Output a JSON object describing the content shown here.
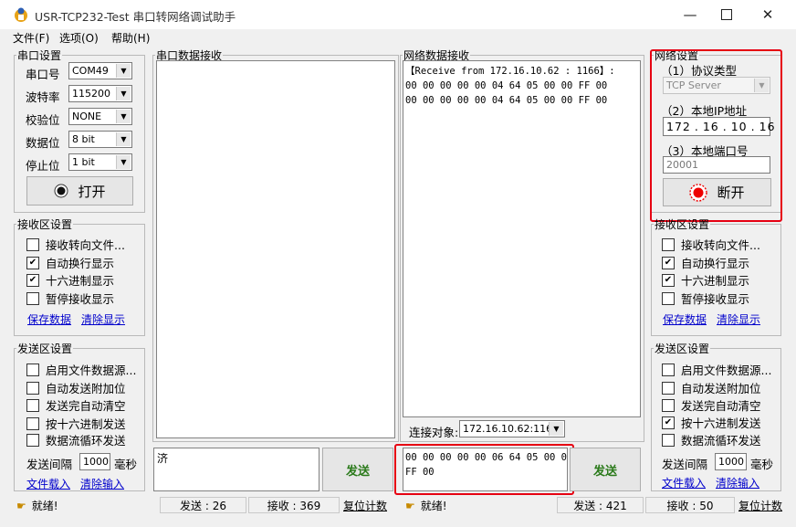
{
  "window": {
    "title": "USR-TCP232-Test  串口转网络调试助手",
    "minimize_icon": "minimize-icon",
    "maximize_icon": "maximize-icon",
    "close_icon": "close-icon"
  },
  "menu": [
    "文件(F)",
    "选项(O)",
    "帮助(H)"
  ],
  "serial_settings": {
    "title": "串口设置",
    "fields": [
      {
        "label": "串口号",
        "value": "COM49"
      },
      {
        "label": "波特率",
        "value": "115200"
      },
      {
        "label": "校验位",
        "value": "NONE"
      },
      {
        "label": "数据位",
        "value": "8 bit"
      },
      {
        "label": "停止位",
        "value": "1 bit"
      }
    ],
    "open_button": "打开"
  },
  "left_recv_settings": {
    "title": "接收区设置",
    "options": [
      {
        "label": "接收转向文件...",
        "checked": false
      },
      {
        "label": "自动换行显示",
        "checked": true
      },
      {
        "label": "十六进制显示",
        "checked": true
      },
      {
        "label": "暂停接收显示",
        "checked": false
      }
    ],
    "save_link": "保存数据",
    "clear_link": "清除显示"
  },
  "left_send_settings": {
    "title": "发送区设置",
    "options": [
      {
        "label": "启用文件数据源...",
        "checked": false
      },
      {
        "label": "自动发送附加位",
        "checked": false
      },
      {
        "label": "发送完自动清空",
        "checked": false
      },
      {
        "label": "按十六进制发送",
        "checked": false
      },
      {
        "label": "数据流循环发送",
        "checked": false
      }
    ],
    "interval_label": "发送间隔",
    "interval_value": "1000",
    "interval_unit": "毫秒",
    "load_link": "文件载入",
    "clear_link": "清除输入"
  },
  "serial_receive": {
    "title": "串口数据接收",
    "content": ""
  },
  "serial_send": {
    "content": "济",
    "send_button": "发送"
  },
  "net_receive": {
    "title": "网络数据接收",
    "lines": [
      "【Receive from 172.16.10.62 : 1166】:",
      "00 00 00 00 00 04 64 05 00 00 FF 00",
      "00 00 00 00 00 04 64 05 00 00 FF 00"
    ]
  },
  "connection": {
    "label": "连接对象:",
    "value": "172.16.10.62:1166"
  },
  "net_send": {
    "lines": [
      "00 00 00 00 00 06 64 05 00 00",
      "FF 00"
    ],
    "send_button": "发送"
  },
  "net_settings": {
    "title": "网络设置",
    "protocol_label": "（1）协议类型",
    "protocol_value": "TCP Server",
    "ip_label": "（2）本地IP地址",
    "ip_parts": [
      "172",
      "16",
      "10",
      "16"
    ],
    "port_label": "（3）本地端口号",
    "port_value": "20001",
    "disconnect_button": "断开"
  },
  "right_recv_settings": {
    "title": "接收区设置",
    "options": [
      {
        "label": "接收转向文件...",
        "checked": false
      },
      {
        "label": "自动换行显示",
        "checked": true
      },
      {
        "label": "十六进制显示",
        "checked": true
      },
      {
        "label": "暂停接收显示",
        "checked": false
      }
    ],
    "save_link": "保存数据",
    "clear_link": "清除显示"
  },
  "right_send_settings": {
    "title": "发送区设置",
    "options": [
      {
        "label": "启用文件数据源...",
        "checked": false
      },
      {
        "label": "自动发送附加位",
        "checked": false
      },
      {
        "label": "发送完自动清空",
        "checked": false
      },
      {
        "label": "按十六进制发送",
        "checked": true
      },
      {
        "label": "数据流循环发送",
        "checked": false
      }
    ],
    "interval_label": "发送间隔",
    "interval_value": "1000",
    "interval_unit": "毫秒",
    "load_link": "文件载入",
    "clear_link": "清除输入"
  },
  "status_left": {
    "ready": "就绪!",
    "sent": "发送 : 26",
    "received": "接收 : 369",
    "reset": "复位计数"
  },
  "status_right": {
    "ready": "就绪!",
    "sent": "发送 : 421",
    "received": "接收 : 50",
    "reset": "复位计数"
  },
  "colors": {
    "highlight_box": "#e60012",
    "send_button_text": "#2a7a1a",
    "link": "#0000cc"
  }
}
